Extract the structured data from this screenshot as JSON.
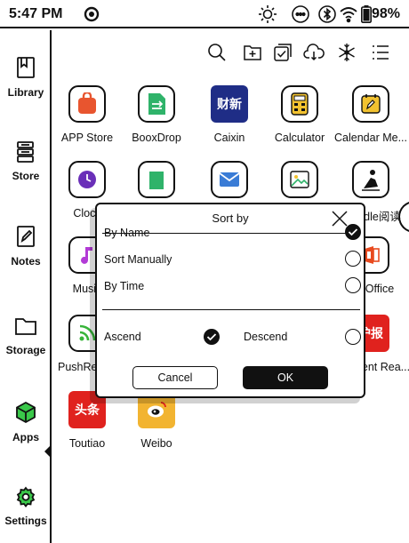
{
  "status": {
    "time": "5:47 PM",
    "battery": "98%"
  },
  "sidebar": {
    "items": [
      {
        "label": "Library"
      },
      {
        "label": "Store"
      },
      {
        "label": "Notes"
      },
      {
        "label": "Storage"
      },
      {
        "label": "Apps"
      },
      {
        "label": "Settings"
      }
    ]
  },
  "toolbar": {
    "icons": [
      "search-icon",
      "add-folder-icon",
      "multi-select-icon",
      "cloud-sync-icon",
      "freeze-icon",
      "list-view-icon"
    ]
  },
  "apps": [
    {
      "label": "APP Store"
    },
    {
      "label": "BooxDrop"
    },
    {
      "label": "Caixin",
      "icon_text": "财新"
    },
    {
      "label": "Calculator"
    },
    {
      "label": "Calendar Me..."
    },
    {
      "label": "Clock"
    },
    {
      "label": "dle阅读"
    },
    {
      "label": "Music"
    },
    {
      "label": "Office"
    },
    {
      "label": "PushRead"
    },
    {
      "label": "ent Rea...",
      "icon_text": "护报"
    },
    {
      "label": "Toutiao",
      "icon_text": "头条"
    },
    {
      "label": "Weibo"
    }
  ],
  "dialog": {
    "title": "Sort by",
    "options": [
      {
        "label": "By Name",
        "checked": true
      },
      {
        "label": "Sort Manually",
        "checked": false
      },
      {
        "label": "By Time",
        "checked": false
      }
    ],
    "order": {
      "ascend": {
        "label": "Ascend",
        "checked": true
      },
      "descend": {
        "label": "Descend",
        "checked": false
      }
    },
    "cancel_label": "Cancel",
    "ok_label": "OK"
  },
  "colors": {
    "appstore": "#e8552f",
    "booxdrop": "#2fb36a",
    "caixin": "#1f2d86",
    "calculator": "#f2c230",
    "calendar": "#f2c230",
    "clock": "#6a2fb8",
    "music": "#b23ad6",
    "office": "#e84a1f",
    "pushread": "#38b43a",
    "toutiao": "#e0221e",
    "weibo": "#f2b431"
  }
}
